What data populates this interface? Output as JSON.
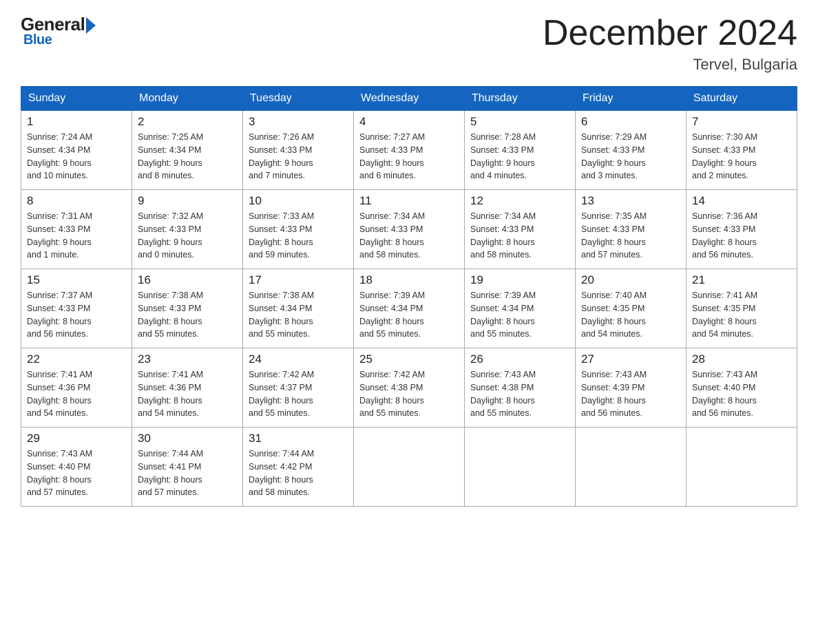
{
  "header": {
    "logo_general": "General",
    "logo_blue": "Blue",
    "title": "December 2024",
    "subtitle": "Tervel, Bulgaria"
  },
  "days_of_week": [
    "Sunday",
    "Monday",
    "Tuesday",
    "Wednesday",
    "Thursday",
    "Friday",
    "Saturday"
  ],
  "weeks": [
    [
      {
        "day": "1",
        "sunrise": "7:24 AM",
        "sunset": "4:34 PM",
        "daylight": "9 hours and 10 minutes."
      },
      {
        "day": "2",
        "sunrise": "7:25 AM",
        "sunset": "4:34 PM",
        "daylight": "9 hours and 8 minutes."
      },
      {
        "day": "3",
        "sunrise": "7:26 AM",
        "sunset": "4:33 PM",
        "daylight": "9 hours and 7 minutes."
      },
      {
        "day": "4",
        "sunrise": "7:27 AM",
        "sunset": "4:33 PM",
        "daylight": "9 hours and 6 minutes."
      },
      {
        "day": "5",
        "sunrise": "7:28 AM",
        "sunset": "4:33 PM",
        "daylight": "9 hours and 4 minutes."
      },
      {
        "day": "6",
        "sunrise": "7:29 AM",
        "sunset": "4:33 PM",
        "daylight": "9 hours and 3 minutes."
      },
      {
        "day": "7",
        "sunrise": "7:30 AM",
        "sunset": "4:33 PM",
        "daylight": "9 hours and 2 minutes."
      }
    ],
    [
      {
        "day": "8",
        "sunrise": "7:31 AM",
        "sunset": "4:33 PM",
        "daylight": "9 hours and 1 minute."
      },
      {
        "day": "9",
        "sunrise": "7:32 AM",
        "sunset": "4:33 PM",
        "daylight": "9 hours and 0 minutes."
      },
      {
        "day": "10",
        "sunrise": "7:33 AM",
        "sunset": "4:33 PM",
        "daylight": "8 hours and 59 minutes."
      },
      {
        "day": "11",
        "sunrise": "7:34 AM",
        "sunset": "4:33 PM",
        "daylight": "8 hours and 58 minutes."
      },
      {
        "day": "12",
        "sunrise": "7:34 AM",
        "sunset": "4:33 PM",
        "daylight": "8 hours and 58 minutes."
      },
      {
        "day": "13",
        "sunrise": "7:35 AM",
        "sunset": "4:33 PM",
        "daylight": "8 hours and 57 minutes."
      },
      {
        "day": "14",
        "sunrise": "7:36 AM",
        "sunset": "4:33 PM",
        "daylight": "8 hours and 56 minutes."
      }
    ],
    [
      {
        "day": "15",
        "sunrise": "7:37 AM",
        "sunset": "4:33 PM",
        "daylight": "8 hours and 56 minutes."
      },
      {
        "day": "16",
        "sunrise": "7:38 AM",
        "sunset": "4:33 PM",
        "daylight": "8 hours and 55 minutes."
      },
      {
        "day": "17",
        "sunrise": "7:38 AM",
        "sunset": "4:34 PM",
        "daylight": "8 hours and 55 minutes."
      },
      {
        "day": "18",
        "sunrise": "7:39 AM",
        "sunset": "4:34 PM",
        "daylight": "8 hours and 55 minutes."
      },
      {
        "day": "19",
        "sunrise": "7:39 AM",
        "sunset": "4:34 PM",
        "daylight": "8 hours and 55 minutes."
      },
      {
        "day": "20",
        "sunrise": "7:40 AM",
        "sunset": "4:35 PM",
        "daylight": "8 hours and 54 minutes."
      },
      {
        "day": "21",
        "sunrise": "7:41 AM",
        "sunset": "4:35 PM",
        "daylight": "8 hours and 54 minutes."
      }
    ],
    [
      {
        "day": "22",
        "sunrise": "7:41 AM",
        "sunset": "4:36 PM",
        "daylight": "8 hours and 54 minutes."
      },
      {
        "day": "23",
        "sunrise": "7:41 AM",
        "sunset": "4:36 PM",
        "daylight": "8 hours and 54 minutes."
      },
      {
        "day": "24",
        "sunrise": "7:42 AM",
        "sunset": "4:37 PM",
        "daylight": "8 hours and 55 minutes."
      },
      {
        "day": "25",
        "sunrise": "7:42 AM",
        "sunset": "4:38 PM",
        "daylight": "8 hours and 55 minutes."
      },
      {
        "day": "26",
        "sunrise": "7:43 AM",
        "sunset": "4:38 PM",
        "daylight": "8 hours and 55 minutes."
      },
      {
        "day": "27",
        "sunrise": "7:43 AM",
        "sunset": "4:39 PM",
        "daylight": "8 hours and 56 minutes."
      },
      {
        "day": "28",
        "sunrise": "7:43 AM",
        "sunset": "4:40 PM",
        "daylight": "8 hours and 56 minutes."
      }
    ],
    [
      {
        "day": "29",
        "sunrise": "7:43 AM",
        "sunset": "4:40 PM",
        "daylight": "8 hours and 57 minutes."
      },
      {
        "day": "30",
        "sunrise": "7:44 AM",
        "sunset": "4:41 PM",
        "daylight": "8 hours and 57 minutes."
      },
      {
        "day": "31",
        "sunrise": "7:44 AM",
        "sunset": "4:42 PM",
        "daylight": "8 hours and 58 minutes."
      },
      null,
      null,
      null,
      null
    ]
  ],
  "labels": {
    "sunrise": "Sunrise:",
    "sunset": "Sunset:",
    "daylight": "Daylight:"
  }
}
